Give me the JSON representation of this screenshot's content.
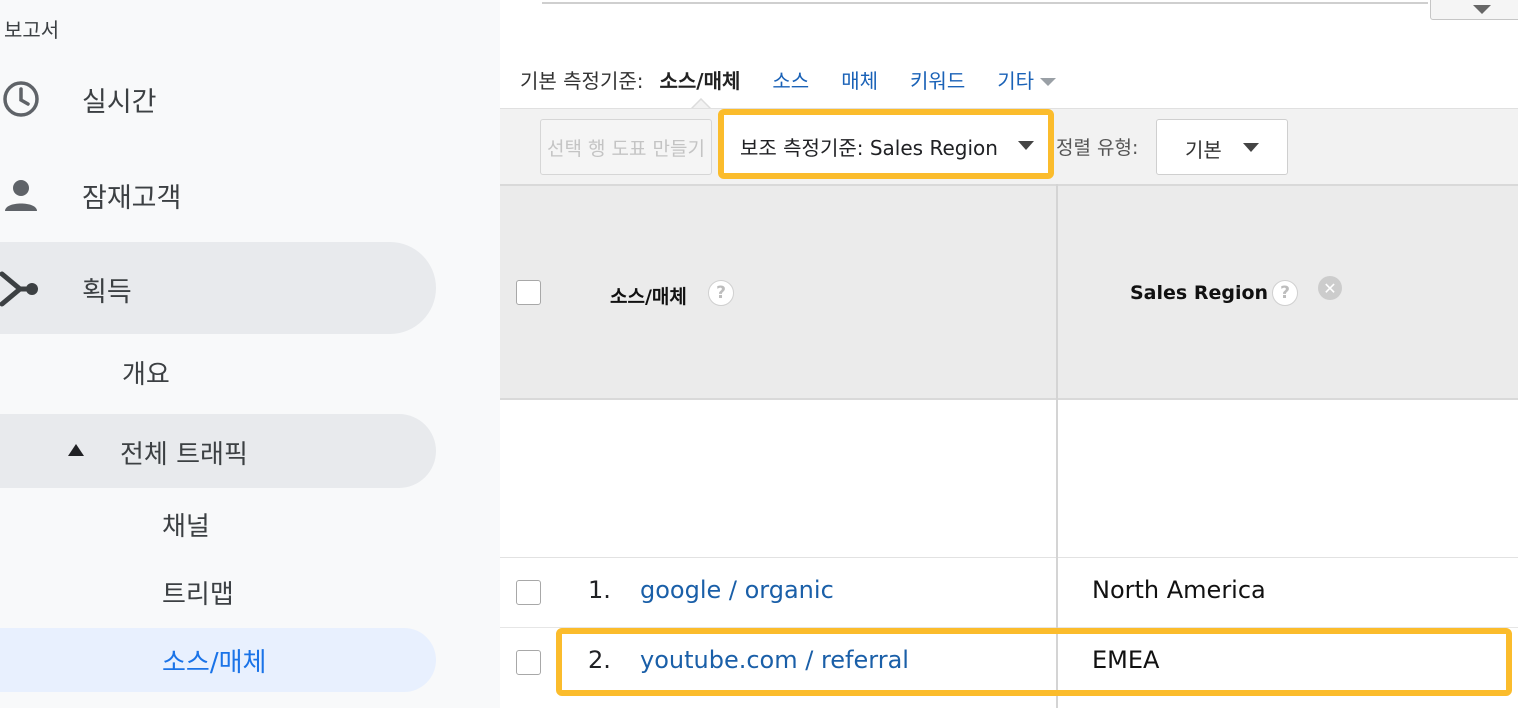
{
  "sidebar": {
    "section_title": "보고서",
    "items": [
      {
        "icon": "clock-icon",
        "label": "실시간"
      },
      {
        "icon": "person-icon",
        "label": "잠재고객"
      },
      {
        "icon": "acquisition-icon",
        "label": "획득"
      }
    ],
    "sub_items": {
      "overview": "개요",
      "all_traffic": "전체 트래픽",
      "channels": "채널",
      "treemaps": "트리맵",
      "source_medium": "소스/매체"
    }
  },
  "dimensions": {
    "primary_label": "기본 측정기준:",
    "current": "소스/매체",
    "links": [
      "소스",
      "매체",
      "키워드"
    ],
    "more": "기타"
  },
  "toolbar": {
    "plot_rows_label": "선택 행 도표 만들기",
    "secondary_dimension_label": "보조 측정기준: Sales Region",
    "sort_type_label": "정렬 유형:",
    "sort_type_value": "기본"
  },
  "table": {
    "headers": {
      "source_medium": "소스/매체",
      "sales_region": "Sales Region"
    },
    "help_glyph": "?",
    "remove_glyph": "✕",
    "rows": [
      {
        "num": "1.",
        "source": "google / organic",
        "region": "North America"
      },
      {
        "num": "2.",
        "source": "youtube.com / referral",
        "region": "EMEA"
      }
    ]
  },
  "colors": {
    "highlight": "#fbbc2c",
    "link": "#1a5fa8",
    "active_nav": "#1a73e8"
  }
}
